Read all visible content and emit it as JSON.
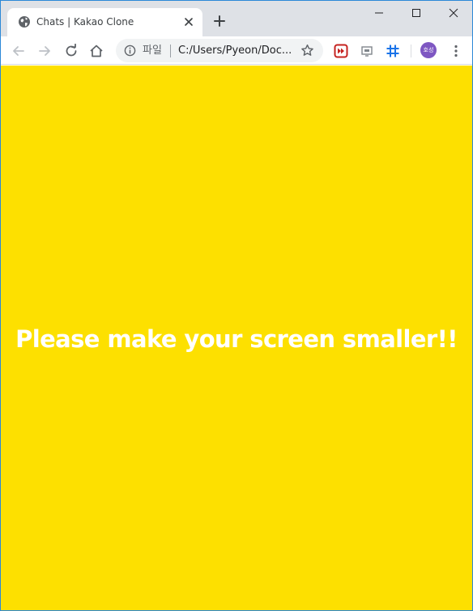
{
  "browser": {
    "tab": {
      "title": "Chats | Kakao Clone"
    },
    "omnibox": {
      "scheme_label": "파일",
      "url": "C:/Users/Pyeon/Doc..."
    },
    "profile": {
      "initials": "호성",
      "color": "#7e57c2"
    },
    "icons": {
      "favicon": "globe-icon",
      "close": "close-icon",
      "new_tab": "plus-icon",
      "back": "arrow-left-icon",
      "forward": "arrow-right-icon",
      "reload": "reload-icon",
      "home": "home-icon",
      "info": "info-icon",
      "bookmark": "star-icon",
      "menu": "kebab-menu-icon"
    }
  },
  "page": {
    "background": "#fde000",
    "message": "Please make your screen smaller!!"
  }
}
